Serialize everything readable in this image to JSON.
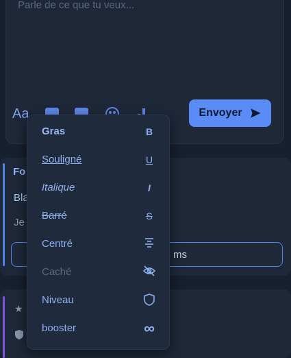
{
  "composer": {
    "placeholder": "Parle de ce que tu veux...",
    "text_style_icon": "Aa",
    "send_label": "Envoyer"
  },
  "card1": {
    "title": "Fo",
    "subtitle": "Bla",
    "text": "Je",
    "button_label": "ms"
  },
  "format_menu": {
    "items": [
      {
        "label": "Gras",
        "icon": "bold-icon",
        "glyph": "B"
      },
      {
        "label": "Souligné",
        "icon": "underline-icon",
        "glyph": "U"
      },
      {
        "label": "Italique",
        "icon": "italic-icon",
        "glyph": "I"
      },
      {
        "label": "Barré",
        "icon": "strikethrough-icon",
        "glyph": "S"
      },
      {
        "label": "Centré",
        "icon": "align-center-icon",
        "glyph": ""
      },
      {
        "label": "Caché",
        "icon": "eye-off-icon",
        "glyph": ""
      },
      {
        "label": "Niveau",
        "icon": "shield-icon",
        "glyph": ""
      },
      {
        "label": "booster",
        "icon": "infinity-icon",
        "glyph": "∞"
      }
    ]
  }
}
